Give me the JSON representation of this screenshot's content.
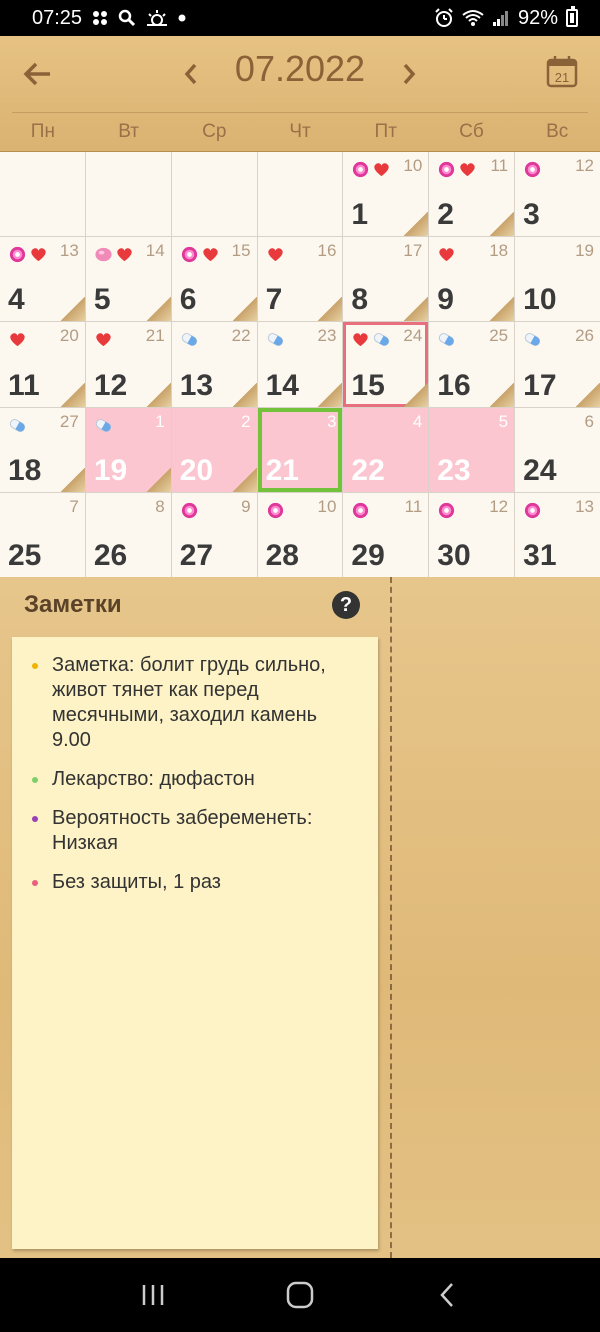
{
  "status": {
    "time": "07:25",
    "battery": "92%"
  },
  "header": {
    "month_title": "07.2022",
    "calendar_icon_day": "21"
  },
  "weekdays": [
    "Пн",
    "Вт",
    "Ср",
    "Чт",
    "Пт",
    "Сб",
    "Вс"
  ],
  "cells": [
    {
      "day": "",
      "cycle": ""
    },
    {
      "day": "",
      "cycle": ""
    },
    {
      "day": "",
      "cycle": ""
    },
    {
      "day": "",
      "cycle": ""
    },
    {
      "day": "1",
      "cycle": "10",
      "icons": [
        "flower",
        "heart"
      ],
      "fold": true
    },
    {
      "day": "2",
      "cycle": "11",
      "icons": [
        "flower",
        "heart"
      ],
      "fold": true
    },
    {
      "day": "3",
      "cycle": "12",
      "icons": [
        "flower"
      ],
      "fold": false
    },
    {
      "day": "4",
      "cycle": "13",
      "icons": [
        "flower",
        "heart"
      ],
      "fold": true
    },
    {
      "day": "5",
      "cycle": "14",
      "icons": [
        "egg",
        "heart"
      ],
      "fold": true
    },
    {
      "day": "6",
      "cycle": "15",
      "icons": [
        "flower",
        "heart"
      ],
      "fold": true
    },
    {
      "day": "7",
      "cycle": "16",
      "icons": [
        "heart"
      ],
      "fold": true
    },
    {
      "day": "8",
      "cycle": "17",
      "icons": [],
      "fold": true
    },
    {
      "day": "9",
      "cycle": "18",
      "icons": [
        "heart"
      ],
      "fold": true
    },
    {
      "day": "10",
      "cycle": "19",
      "icons": [],
      "fold": false
    },
    {
      "day": "11",
      "cycle": "20",
      "icons": [
        "heart"
      ],
      "fold": true
    },
    {
      "day": "12",
      "cycle": "21",
      "icons": [
        "heart"
      ],
      "fold": true
    },
    {
      "day": "13",
      "cycle": "22",
      "icons": [
        "pill"
      ],
      "fold": true
    },
    {
      "day": "14",
      "cycle": "23",
      "icons": [
        "pill"
      ],
      "fold": true
    },
    {
      "day": "15",
      "cycle": "24",
      "icons": [
        "heart",
        "pill"
      ],
      "fold": true,
      "today": true
    },
    {
      "day": "16",
      "cycle": "25",
      "icons": [
        "pill"
      ],
      "fold": true
    },
    {
      "day": "17",
      "cycle": "26",
      "icons": [
        "pill"
      ],
      "fold": true
    },
    {
      "day": "18",
      "cycle": "27",
      "icons": [
        "pill"
      ],
      "fold": true
    },
    {
      "day": "19",
      "cycle": "1",
      "icons": [
        "pill"
      ],
      "fold": true,
      "period": true
    },
    {
      "day": "20",
      "cycle": "2",
      "icons": [],
      "fold": true,
      "period": true
    },
    {
      "day": "21",
      "cycle": "3",
      "icons": [],
      "fold": false,
      "period": true,
      "selected": true
    },
    {
      "day": "22",
      "cycle": "4",
      "icons": [],
      "fold": false,
      "period": true
    },
    {
      "day": "23",
      "cycle": "5",
      "icons": [],
      "fold": false,
      "period": true
    },
    {
      "day": "24",
      "cycle": "6",
      "icons": [],
      "fold": false
    },
    {
      "day": "25",
      "cycle": "7",
      "icons": [],
      "fold": false
    },
    {
      "day": "26",
      "cycle": "8",
      "icons": [],
      "fold": false
    },
    {
      "day": "27",
      "cycle": "9",
      "icons": [
        "flower"
      ],
      "fold": false
    },
    {
      "day": "28",
      "cycle": "10",
      "icons": [
        "flower"
      ],
      "fold": false
    },
    {
      "day": "29",
      "cycle": "11",
      "icons": [
        "flower"
      ],
      "fold": false
    },
    {
      "day": "30",
      "cycle": "12",
      "icons": [
        "flower"
      ],
      "fold": false
    },
    {
      "day": "31",
      "cycle": "13",
      "icons": [
        "flower"
      ],
      "fold": false
    }
  ],
  "notes": {
    "title": "Заметки",
    "help": "?",
    "items": [
      {
        "text": "Заметка:  болит грудь сильно, живот тянет как перед месячными, заходил камень 9.00",
        "color": "#f0b400"
      },
      {
        "text": "Лекарство:  дюфастон",
        "color": "#7ccf6a"
      },
      {
        "text": "Вероятность забеременеть: Низкая",
        "color": "#9b3fb5"
      },
      {
        "text": "Без защиты, 1 раз",
        "color": "#e8607e"
      }
    ]
  }
}
